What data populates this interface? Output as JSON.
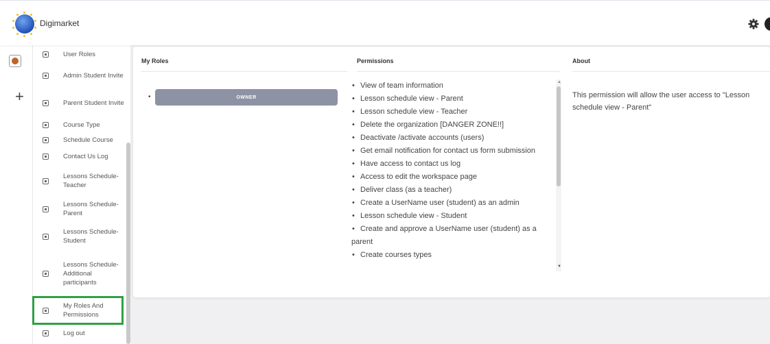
{
  "app": {
    "brand": "Digimarket"
  },
  "sidebar": {
    "items": [
      {
        "label": "User Roles"
      },
      {
        "label": "Admin Student Invite"
      },
      {
        "label": "Parent Student Invite"
      },
      {
        "label": "Course Type"
      },
      {
        "label": "Schedule Course"
      },
      {
        "label": "Contact Us Log"
      },
      {
        "label": "Lessons Schedule-Teacher"
      },
      {
        "label": "Lessons Schedule-Parent"
      },
      {
        "label": "Lessons Schedule-Student"
      },
      {
        "label": "Lessons Schedule-Additional participants"
      },
      {
        "label": "My Roles And Permissions"
      },
      {
        "label": "Log out"
      }
    ]
  },
  "main": {
    "my_roles": {
      "title": "My Roles",
      "roles": [
        "OWNER"
      ]
    },
    "permissions": {
      "title": "Permissions",
      "items": [
        "View of team information",
        "Lesson schedule view - Parent",
        "Lesson schedule view - Teacher",
        "Delete the organization [DANGER ZONE!!]",
        "Deactivate /activate accounts (users)",
        "Get email notification for contact us form submission",
        "Have access to contact us log",
        "Access to edit the workspace page",
        "Deliver class (as a teacher)",
        "Create a UserName user (student) as an admin",
        "Lesson schedule view - Student",
        "Create and approve a UserName user (student) as a parent",
        "Create courses types"
      ]
    },
    "about": {
      "title": "About",
      "text": "This permission will allow the user access to \"Lesson schedule view - Parent\""
    }
  },
  "colors": {
    "highlight": "#2ea043",
    "role_button": "#8d93a4"
  }
}
